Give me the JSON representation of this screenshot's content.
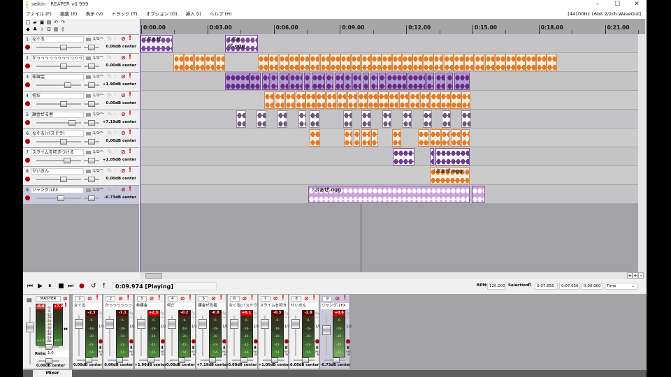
{
  "window": {
    "title": "seikin - REAPER v0.999",
    "min": "–",
    "max": "☐",
    "close": "✕"
  },
  "menu": [
    "ファイル (F)",
    "編集 (E)",
    "表示 (V)",
    "トラック (T)",
    "オプション (O)",
    "挿入 (I)",
    "ヘルプ (H)"
  ],
  "audio_status": "[44100Hz 16bit 2/2ch WaveOut]",
  "toolbar": [
    "new-icon",
    "open-icon",
    "save-icon",
    "project-settings-icon",
    "undo-icon",
    "redo-icon",
    "metronome-icon",
    "routing-icon",
    "auto-crossfade-icon",
    "snap-icon",
    "grid-icon",
    "ripple-icon"
  ],
  "ruler": {
    "ticks": [
      "0:00.00",
      "0:03.00",
      "0:06.00",
      "0:09.00",
      "0:12.00",
      "0:15.00",
      "0:18.00",
      "0:21.00"
    ],
    "tick_seconds": [
      0,
      3,
      6,
      9,
      12,
      15,
      18,
      21
    ]
  },
  "playhead_seconds": 9.974,
  "tracks": [
    {
      "num": "1",
      "name": "なぐる",
      "io": "1/1",
      "vol": "0.00dB center",
      "vol_level": 0.68,
      "color": "#7a4a9c",
      "bg": "#f4eefa",
      "wave": "#7a4a9c",
      "items": [
        [
          0,
          1.46,
          "♪ぶぁぜ"
        ],
        [
          3.83,
          1.49,
          "♪ぶぁぜ.ogg"
        ]
      ]
    },
    {
      "num": "2",
      "name": "かっっっっっっっっっっっっっっった",
      "io": "1/1",
      "vol": "0.00dB center",
      "vol_level": 0.68,
      "color": "#d9884a",
      "bg": "#fbeee2",
      "wave": "#e07b28",
      "items": [
        [
          1.49,
          0.46
        ],
        [
          1.96,
          0.46
        ],
        [
          2.44,
          0.46
        ],
        [
          2.91,
          0.46
        ],
        [
          3.39,
          0.44
        ],
        [
          5.32,
          0.46
        ],
        [
          5.79,
          0.46
        ],
        [
          6.25,
          0.46
        ],
        [
          6.72,
          0.46
        ],
        [
          7.19,
          0.46
        ],
        [
          7.65,
          0.46
        ],
        [
          8.12,
          0.46
        ],
        [
          8.59,
          0.46
        ],
        [
          9.05,
          0.46
        ],
        [
          9.52,
          0.46
        ],
        [
          9.99,
          0.46
        ],
        [
          10.45,
          0.46
        ],
        [
          10.92,
          0.46
        ],
        [
          11.39,
          0.46
        ],
        [
          11.85,
          0.46
        ],
        [
          12.32,
          0.46
        ],
        [
          12.79,
          0.46
        ],
        [
          13.25,
          0.46
        ],
        [
          13.72,
          0.46
        ],
        [
          14.19,
          0.46
        ],
        [
          14.65,
          0.46
        ],
        [
          15.12,
          0.46
        ],
        [
          15.59,
          0.46
        ],
        [
          16.05,
          0.46
        ],
        [
          16.52,
          0.46
        ],
        [
          16.99,
          0.46
        ],
        [
          17.45,
          0.46
        ],
        [
          17.92,
          0.46
        ],
        [
          18.39,
          0.46
        ]
      ]
    },
    {
      "num": "3",
      "name": "非課金",
      "io": "1/1",
      "vol": "+1.90dB center",
      "vol_level": 0.78,
      "color": "#7a4a9c",
      "bg": "#b99ad2",
      "wave": "#5e2f86",
      "items": [
        [
          3.83,
          1.1
        ],
        [
          4.95,
          0.5
        ],
        [
          5.5,
          0.35
        ],
        [
          5.9,
          0.35
        ],
        [
          6.3,
          0.4
        ],
        [
          6.75,
          0.6
        ],
        [
          7.4,
          0.3
        ],
        [
          7.75,
          0.6
        ],
        [
          8.4,
          0.35
        ],
        [
          8.8,
          0.4
        ],
        [
          9.25,
          0.3
        ],
        [
          9.6,
          0.4
        ],
        [
          10.05,
          0.3
        ],
        [
          10.4,
          0.35
        ],
        [
          10.8,
          0.3
        ],
        [
          11.15,
          0.9
        ],
        [
          12.1,
          0.8
        ],
        [
          12.95,
          0.35
        ],
        [
          13.35,
          0.45
        ],
        [
          13.85,
          0.3
        ],
        [
          14.2,
          0.7
        ]
      ]
    },
    {
      "num": "4",
      "name": "何だ",
      "io": "1/1",
      "vol": "0.00dB center",
      "vol_level": 0.68,
      "color": "#d9884a",
      "bg": "#fbeee2",
      "wave": "#e07b28",
      "items": [
        [
          5.6,
          0.45
        ],
        [
          6.07,
          0.45
        ],
        [
          6.54,
          0.45
        ],
        [
          7.01,
          0.45
        ],
        [
          7.48,
          0.45
        ],
        [
          7.95,
          0.45
        ],
        [
          8.42,
          0.45
        ],
        [
          8.89,
          0.45
        ],
        [
          9.36,
          0.45
        ],
        [
          9.83,
          0.45
        ],
        [
          10.3,
          0.45
        ],
        [
          10.77,
          0.45
        ],
        [
          11.24,
          0.45
        ],
        [
          11.71,
          0.45
        ],
        [
          12.18,
          0.45
        ],
        [
          12.65,
          0.45
        ],
        [
          13.12,
          0.45
        ],
        [
          13.59,
          0.45
        ],
        [
          14.06,
          0.45
        ],
        [
          14.53,
          0.4
        ]
      ]
    },
    {
      "num": "5",
      "name": "課金ぜる者",
      "io": "1/1",
      "vol": "+7.19dB center",
      "vol_level": 0.9,
      "color": "#9a8aa8",
      "bg": "#ffffff",
      "wave": "#6b5a7a",
      "items": [
        [
          4.34,
          0.45
        ],
        [
          5.25,
          0.45
        ],
        [
          6.2,
          0.45
        ],
        [
          7.15,
          0.35
        ],
        [
          7.66,
          0.45
        ],
        [
          9.18,
          0.4
        ],
        [
          10.0,
          0.45
        ],
        [
          10.95,
          0.42
        ],
        [
          11.87,
          0.4
        ],
        [
          12.78,
          0.42
        ],
        [
          13.64,
          0.42
        ],
        [
          14.53,
          0.45
        ]
      ]
    },
    {
      "num": "6",
      "name": "なぐる(バスドラ)",
      "io": "1/1",
      "vol": "0.00dB center",
      "vol_level": 0.68,
      "color": "#d9884a",
      "bg": "#fbeee2",
      "wave": "#e07b28",
      "items": [
        [
          7.66,
          0.47
        ],
        [
          9.2,
          0.4
        ],
        [
          9.65,
          0.3
        ],
        [
          10.0,
          0.4
        ],
        [
          10.45,
          0.3
        ],
        [
          11.4,
          0.4
        ],
        [
          12.57,
          0.5
        ],
        [
          13.1,
          0.5
        ],
        [
          13.6,
          0.4
        ],
        [
          14.05,
          0.45
        ],
        [
          14.52,
          0.4
        ]
      ]
    },
    {
      "num": "7",
      "name": "スライムを叩きつける",
      "io": "1/1",
      "vol": "+1.05dB center",
      "vol_level": 0.76,
      "color": "#7a4a9c",
      "bg": "#ffffff",
      "wave": "#6b3d8f",
      "items": [
        [
          11.42,
          1.0
        ],
        [
          13.1,
          0.2
        ],
        [
          13.35,
          1.55
        ]
      ]
    },
    {
      "num": "8",
      "name": "せいきん",
      "io": "1/1",
      "vol": "0.00dB center",
      "vol_level": 0.68,
      "color": "#d9884a",
      "bg": "#fbeee2",
      "wave": "#e07b28",
      "items": [
        [
          13.1,
          1.8,
          "♪ぶぁぜ.ogg"
        ]
      ]
    },
    {
      "num": "9",
      "name": "ジャングルFX",
      "io": "1/1",
      "vol": "-0.73dB center",
      "vol_level": 0.6,
      "color": "#8a5aa8",
      "bg": "#c9a2dc",
      "wave": "#ffffff",
      "selected": true,
      "items": [
        [
          7.6,
          7.3,
          "♪ぶぁぜ.ogg"
        ],
        [
          15.0,
          0.6
        ]
      ]
    }
  ],
  "transport": {
    "buttons": [
      "go-start-icon",
      "play-icon",
      "pause-icon",
      "stop-icon",
      "go-end-icon",
      "record-icon",
      "repeat-icon",
      "metronome-icon"
    ],
    "time": "0:09.974 [Playing]",
    "bpm_label": "BPM:",
    "bpm": "120.000",
    "sel_label": "Selection:",
    "sel_start": "0:07.656",
    "sel_end": "0:07.656",
    "sel_len": "0:00.000",
    "mode": "Time"
  },
  "mixer": {
    "master": {
      "label": "MASTER",
      "peak_l": "-6.8",
      "peak_r": "+7.0",
      "rms_l": "+3.8",
      "rms_r": "+4.7",
      "scale": [
        "-0-",
        "-6-",
        "-12-",
        "-18-",
        "-24-",
        "-30-",
        "-36-",
        "-42-",
        "-48-",
        "-54-",
        "-60-"
      ],
      "rate_label": "Rate:",
      "rate": "1.0",
      "vol": "0.00dB center"
    },
    "scale": [
      "-6-",
      "-18-",
      "-30-",
      "-42-",
      "-54-"
    ],
    "fx": "fx",
    "off": "OFF",
    "rec_in": "REC IN",
    "strips": [
      {
        "num": "1",
        "name": "なぐる",
        "peak": "-2.3",
        "hot": false,
        "vol": "0.00dB center"
      },
      {
        "num": "2",
        "name": "かっっっっっっっっっっっっっっった",
        "peak": "-7.1",
        "hot": false,
        "vol": "0.00dB center"
      },
      {
        "num": "3",
        "name": "非課金",
        "peak": "+2.3",
        "hot": true,
        "vol": "+1.90dB center"
      },
      {
        "num": "4",
        "name": "何だ",
        "peak": "-0.2",
        "hot": false,
        "vol": "0.00dB center"
      },
      {
        "num": "5",
        "name": "課金ぜる者",
        "peak": "-0.8",
        "hot": false,
        "vol": "+7.19dB center"
      },
      {
        "num": "6",
        "name": "なぐる(バスドラ)",
        "peak": "+0.1",
        "hot": true,
        "vol": "0.00dB center"
      },
      {
        "num": "7",
        "name": "スライムを叩きつける",
        "peak": "-0.3",
        "hot": false,
        "vol": "+1.05dB center"
      },
      {
        "num": "8",
        "name": "せいきん",
        "peak": "-2.8",
        "hot": false,
        "vol": "0.00dB center"
      },
      {
        "num": "9",
        "name": "ジャングルFX",
        "peak": "+0.6",
        "hot": true,
        "vol": "-0.73dB center",
        "selected": true
      }
    ],
    "tab": "Mixer"
  }
}
